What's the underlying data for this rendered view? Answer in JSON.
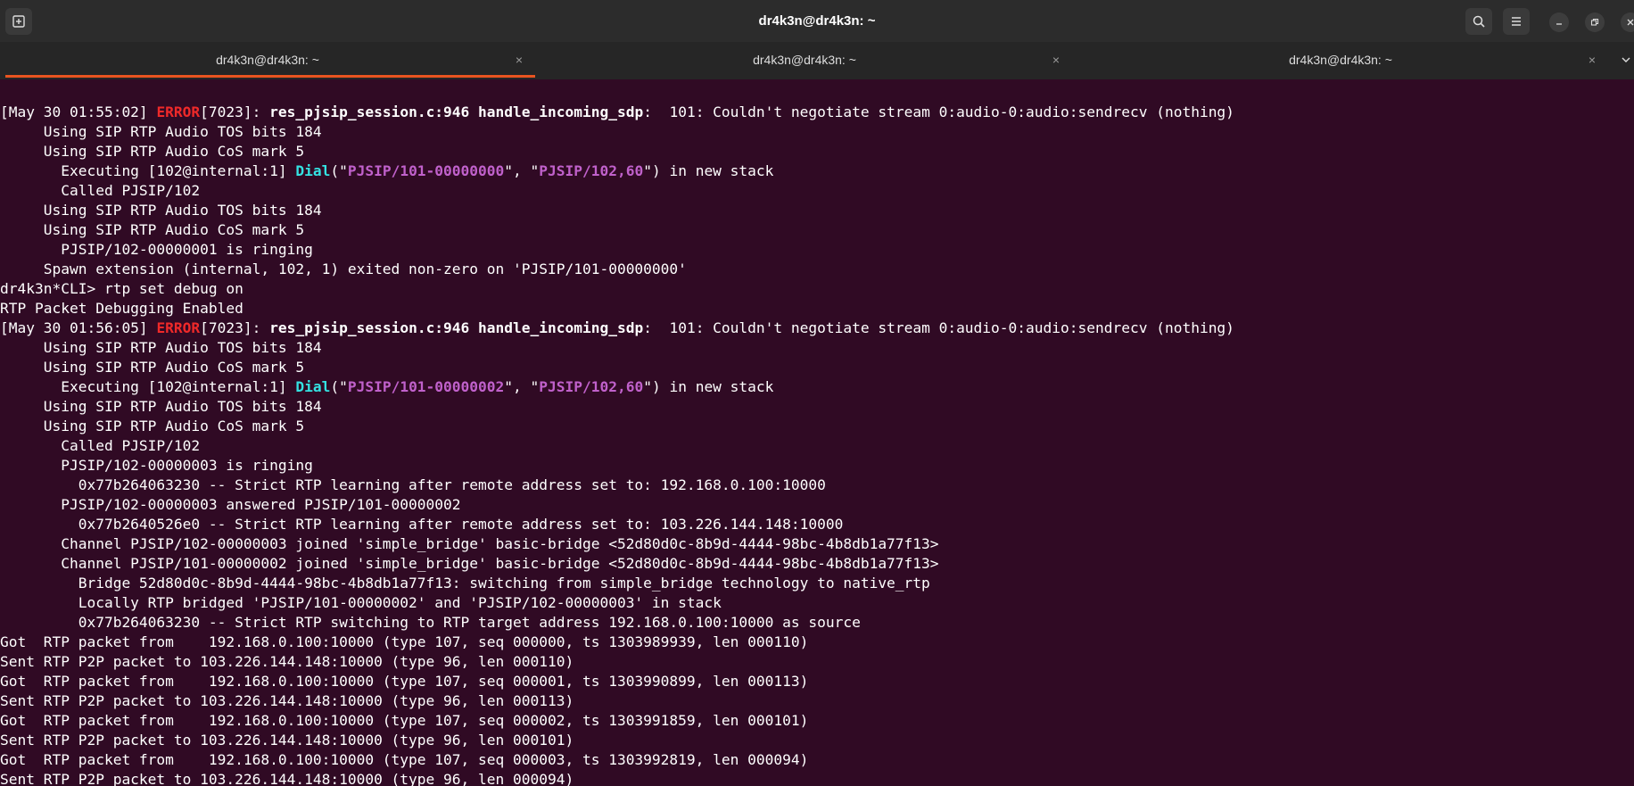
{
  "window": {
    "title": "dr4k3n@dr4k3n: ~"
  },
  "titlebar": {
    "new_tab_icon": "new-tab-icon",
    "search_icon": "search-icon",
    "menu_icon": "hamburger-menu-icon",
    "minimize_icon": "minimize-icon",
    "maximize_icon": "restore-icon",
    "close_icon": "close-icon"
  },
  "tabs": [
    {
      "label": "dr4k3n@dr4k3n: ~",
      "close": "×",
      "active": true
    },
    {
      "label": "dr4k3n@dr4k3n: ~",
      "close": "×",
      "active": false
    },
    {
      "label": "dr4k3n@dr4k3n: ~",
      "close": "×",
      "active": false
    }
  ],
  "colors": {
    "terminal_bg": "#300a24",
    "error": "#ef2929",
    "app_name": "#34e2e2",
    "argument": "#c061cb",
    "tab_indicator": "#e95420"
  },
  "terminal": {
    "l0": {
      "a": "[May 30 01:55:02] ",
      "b": "ERROR",
      "c": "[7023]: ",
      "d": "res_pjsip_session.c:946 handle_incoming_sdp",
      "e": ":  101: Couldn't negotiate stream 0:audio-0:audio:sendrecv (nothing)"
    },
    "l1": "     Using SIP RTP Audio TOS bits 184",
    "l2": "     Using SIP RTP Audio CoS mark 5",
    "l3": {
      "a": "       Executing [102@internal:1] ",
      "b": "Dial",
      "c": "(\"",
      "d": "PJSIP/101-00000000",
      "e": "\", \"",
      "f": "PJSIP/102,60",
      "g": "\") in new stack"
    },
    "l4": "       Called PJSIP/102",
    "l5": "     Using SIP RTP Audio TOS bits 184",
    "l6": "     Using SIP RTP Audio CoS mark 5",
    "l7": "       PJSIP/102-00000001 is ringing",
    "l8": "     Spawn extension (internal, 102, 1) exited non-zero on 'PJSIP/101-00000000'",
    "l9": "dr4k3n*CLI> rtp set debug on",
    "l10": "RTP Packet Debugging Enabled",
    "l11": {
      "a": "[May 30 01:56:05] ",
      "b": "ERROR",
      "c": "[7023]: ",
      "d": "res_pjsip_session.c:946 handle_incoming_sdp",
      "e": ":  101: Couldn't negotiate stream 0:audio-0:audio:sendrecv (nothing)"
    },
    "l12": "     Using SIP RTP Audio TOS bits 184",
    "l13": "     Using SIP RTP Audio CoS mark 5",
    "l14": {
      "a": "       Executing [102@internal:1] ",
      "b": "Dial",
      "c": "(\"",
      "d": "PJSIP/101-00000002",
      "e": "\", \"",
      "f": "PJSIP/102,60",
      "g": "\") in new stack"
    },
    "l15": "     Using SIP RTP Audio TOS bits 184",
    "l16": "     Using SIP RTP Audio CoS mark 5",
    "l17": "       Called PJSIP/102",
    "l18": "       PJSIP/102-00000003 is ringing",
    "l19": "         0x77b264063230 -- Strict RTP learning after remote address set to: 192.168.0.100:10000",
    "l20": "       PJSIP/102-00000003 answered PJSIP/101-00000002",
    "l21": "         0x77b2640526e0 -- Strict RTP learning after remote address set to: 103.226.144.148:10000",
    "l22": "       Channel PJSIP/102-00000003 joined 'simple_bridge' basic-bridge <52d80d0c-8b9d-4444-98bc-4b8db1a77f13>",
    "l23": "       Channel PJSIP/101-00000002 joined 'simple_bridge' basic-bridge <52d80d0c-8b9d-4444-98bc-4b8db1a77f13>",
    "l24": "         Bridge 52d80d0c-8b9d-4444-98bc-4b8db1a77f13: switching from simple_bridge technology to native_rtp",
    "l25": "         Locally RTP bridged 'PJSIP/101-00000002' and 'PJSIP/102-00000003' in stack",
    "l26": "         0x77b264063230 -- Strict RTP switching to RTP target address 192.168.0.100:10000 as source",
    "l27": "Got  RTP packet from    192.168.0.100:10000 (type 107, seq 000000, ts 1303989939, len 000110)",
    "l28": "Sent RTP P2P packet to 103.226.144.148:10000 (type 96, len 000110)",
    "l29": "Got  RTP packet from    192.168.0.100:10000 (type 107, seq 000001, ts 1303990899, len 000113)",
    "l30": "Sent RTP P2P packet to 103.226.144.148:10000 (type 96, len 000113)",
    "l31": "Got  RTP packet from    192.168.0.100:10000 (type 107, seq 000002, ts 1303991859, len 000101)",
    "l32": "Sent RTP P2P packet to 103.226.144.148:10000 (type 96, len 000101)",
    "l33": "Got  RTP packet from    192.168.0.100:10000 (type 107, seq 000003, ts 1303992819, len 000094)",
    "l34": "Sent RTP P2P packet to 103.226.144.148:10000 (type 96, len 000094)"
  }
}
